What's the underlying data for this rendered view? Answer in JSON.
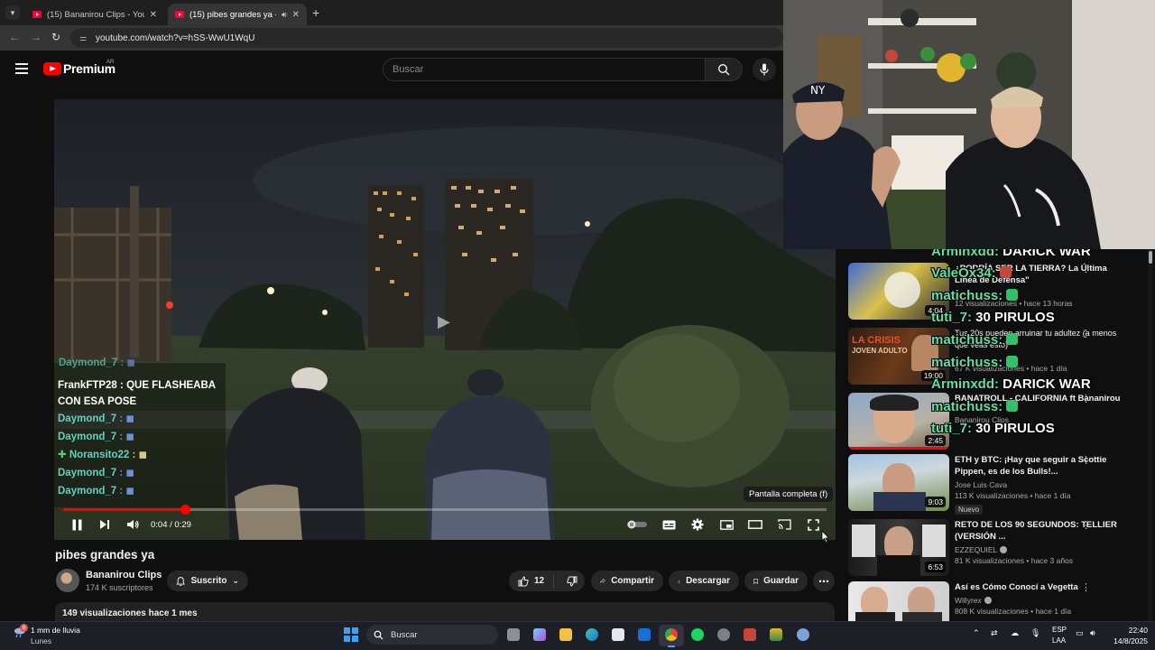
{
  "browser": {
    "tabs": [
      {
        "title": "(15) Bananirou Clips - YouTube",
        "active": false
      },
      {
        "title": "(15) pibes grandes ya - YouTube",
        "active": true
      }
    ],
    "url": "youtube.com/watch?v=hSS-WwU1WqU"
  },
  "header": {
    "brand": "Premium",
    "region": "AR",
    "search_placeholder": "Buscar"
  },
  "player": {
    "current_time": "0:04",
    "duration": "0:29",
    "time_display": "0:04 / 0:29",
    "progress_fraction": 0.16,
    "tooltip": "Pantalla completa (f)",
    "chat": [
      {
        "user": "Daymond_7",
        "message": ""
      },
      {
        "user": "FrankFTP28",
        "message": "QUE FLASHEABA CON ESA POSE"
      },
      {
        "user": "Daymond_7",
        "message": ""
      },
      {
        "user": "Daymond_7",
        "message": ""
      },
      {
        "user": "Noransito22",
        "message": ""
      },
      {
        "user": "Daymond_7",
        "message": ""
      },
      {
        "user": "Daymond_7",
        "message": ""
      }
    ]
  },
  "video": {
    "title": "pibes grandes ya",
    "channel": "Bananirou Clips",
    "subscribers": "174 K suscriptores",
    "subscribe_label": "Suscrito",
    "likes": "12",
    "share_label": "Compartir",
    "download_label": "Descargar",
    "save_label": "Guardar",
    "views_date": "149 visualizaciones  hace 1 mes"
  },
  "recommendations": [
    {
      "title": "¿PODRÍA SER LA TIERRA? La Última Línea de Defensa\"",
      "channel": "",
      "views": "12 visualizaciones • hace 13 horas",
      "duration": "4:04",
      "verified": false,
      "badge": ""
    },
    {
      "title": "Tus 20s pueden arruinar tu adultez (a menos que veas esto)",
      "channel": "",
      "views": "67 K visualizaciones • hace 1 día",
      "duration": "19:00",
      "verified": false,
      "badge": "",
      "thumb_text": "LA CRISIS",
      "thumb_sub": "JOVEN ADULTO"
    },
    {
      "title": "BANATROLL - CALIFORNIA ft Bananirou",
      "channel": "Bananirou Clips",
      "views": "",
      "duration": "2:45",
      "verified": false,
      "badge": ""
    },
    {
      "title": "ETH y BTC: ¡Hay que seguir a Scottie Pippen, es de los Bulls!...",
      "channel": "Jose Luis Cava",
      "views": "113 K visualizaciones • hace 1 día",
      "duration": "9:03",
      "verified": false,
      "badge": "Nuevo"
    },
    {
      "title": "RETO DE LOS 90 SEGUNDOS: TELLIER (VERSIÓN ...",
      "channel": "EZZEQUIEL",
      "views": "81 K visualizaciones • hace 3 años",
      "duration": "6:53",
      "verified": true,
      "badge": ""
    },
    {
      "title": "Así es Cómo Conocí a Vegetta",
      "channel": "Willyrex",
      "views": "808 K visualizaciones • hace 1 día",
      "duration": "",
      "verified": true,
      "badge": ""
    }
  ],
  "overlay_chat": [
    {
      "user": "Arminxdd:",
      "message": "DARICK WAR",
      "emote": false
    },
    {
      "user": "ValeOx34:",
      "message": "",
      "emote": true
    },
    {
      "user": "matichuss:",
      "message": "",
      "emote": true
    },
    {
      "user": "tuti_7:",
      "message": "30 PIRULOS",
      "emote": false
    },
    {
      "user": "matichuss:",
      "message": "",
      "emote": true
    },
    {
      "user": "matichuss:",
      "message": "",
      "emote": true
    },
    {
      "user": "Arminxdd:",
      "message": "DARICK WAR",
      "emote": false
    },
    {
      "user": "matichuss:",
      "message": "",
      "emote": true
    },
    {
      "user": "tuti_7:",
      "message": "30 PIRULOS",
      "emote": false
    }
  ],
  "taskbar": {
    "weather_temp": "1 mm de lluvia",
    "weather_day": "Lunes",
    "search": "Buscar",
    "lang_1": "ESP",
    "lang_2": "LAA",
    "time": "22:40",
    "date": "14/8/2025",
    "notification_count": "6"
  },
  "colors": {
    "youtube_red": "#ff0000",
    "chat_name": "#5fe1a8",
    "background": "#0f0f0f"
  }
}
